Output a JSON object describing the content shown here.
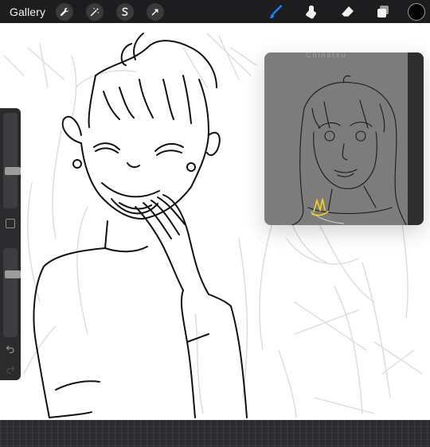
{
  "toolbar": {
    "gallery_label": "Gallery",
    "left_tools": [
      "wrench-icon",
      "magic-wand-icon",
      "selection-icon",
      "transform-arrow-icon"
    ],
    "right_tools": [
      "brush-icon",
      "smudge-icon",
      "eraser-icon",
      "layers-icon"
    ],
    "active_tool": "brush",
    "accent_color": "#1e7fff",
    "current_color": "#050505"
  },
  "reference": {
    "header_text": "Chinatsu"
  },
  "sidebar": {
    "brush_size_level": 0.38,
    "opacity_level": 0.73,
    "undo_icon": "undo-icon",
    "redo_icon": "redo-icon"
  }
}
